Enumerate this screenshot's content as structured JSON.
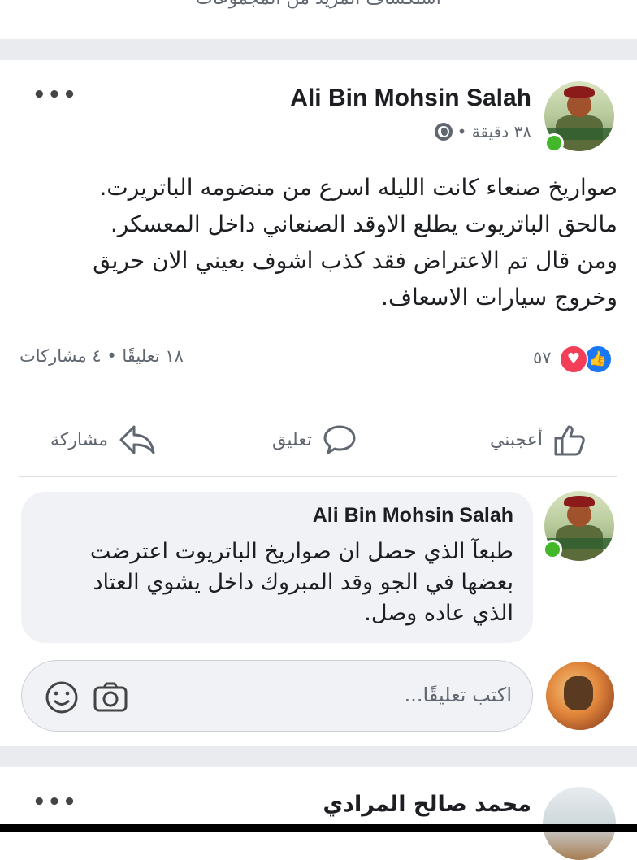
{
  "top_hint": "استكشاف المزيد من المجموعات",
  "post": {
    "author": "Ali Bin Mohsin Salah",
    "time": "٣٨ دقيقة •",
    "body_lines": [
      "صواريخ صنعاء كانت الليله اسرع من منضومه الباتريرت.",
      "مالحق الباتريوت يطلع الاوقد الصنعاني داخل المعسكر.",
      "ومن قال تم الاعتراض فقد كذب اشوف بعيني الان حريق",
      "وخروج سيارات الاسعاف."
    ],
    "reactions_count": "٥٧",
    "stats": "١٨ تعليقًا • ٤ مشاركات",
    "actions": {
      "like": "أعجبني",
      "comment": "تعليق",
      "share": "مشاركة"
    },
    "more_icon": "more-dots-icon"
  },
  "comment": {
    "author": "Ali Bin Mohsin Salah",
    "text_lines": [
      "طبعآ الذي حصل ان صواريخ الباتريوت اعترضت",
      "بعضها في الجو وقد المبروك داخل يشوي  العتاد",
      "الذي عاده وصل."
    ]
  },
  "composer": {
    "placeholder": "اكتب تعليقًا..."
  },
  "next_post": {
    "author": "محمد صالح المرادي"
  },
  "colors": {
    "like_blue": "#1877f2",
    "love_red": "#f33e58",
    "online_green": "#42b72a",
    "separator": "#e9ebee"
  }
}
